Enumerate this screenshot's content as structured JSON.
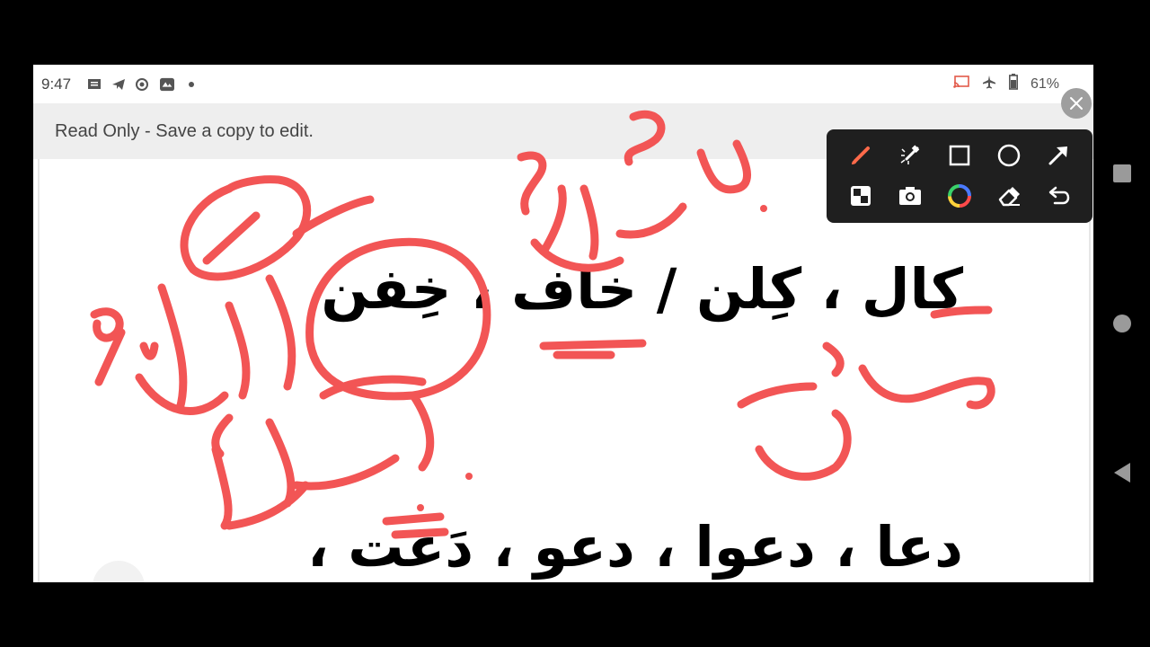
{
  "status_bar": {
    "time": "9:47",
    "left_icons": [
      "message-icon",
      "telegram-icon",
      "recorder-icon",
      "gallery-icon",
      "dot-icon"
    ],
    "right_icons": [
      "cast-icon",
      "airplane-icon",
      "battery-icon"
    ],
    "battery": "61%"
  },
  "banner": {
    "text": "Read Only - Save a copy to edit."
  },
  "document": {
    "line1": "كال ، كِلن / خاف ، خِفن",
    "line2": "دعا ، دعوا ، دعو ، دَعت ،"
  },
  "annotation_toolbar": {
    "tools": [
      "brush-icon",
      "laser-pointer-icon",
      "rectangle-icon",
      "circle-icon",
      "arrow-icon",
      "mosaic-icon",
      "camera-icon",
      "color-wheel-icon",
      "eraser-icon",
      "undo-icon"
    ],
    "accent_color": "#ff5a5a"
  },
  "colors": {
    "ink": "#f25555",
    "toolbar_bg": "#1f1f1f",
    "banner_bg": "#eeeeee"
  },
  "nav_bar": {
    "buttons": [
      "recents-button",
      "home-button",
      "back-button"
    ]
  }
}
